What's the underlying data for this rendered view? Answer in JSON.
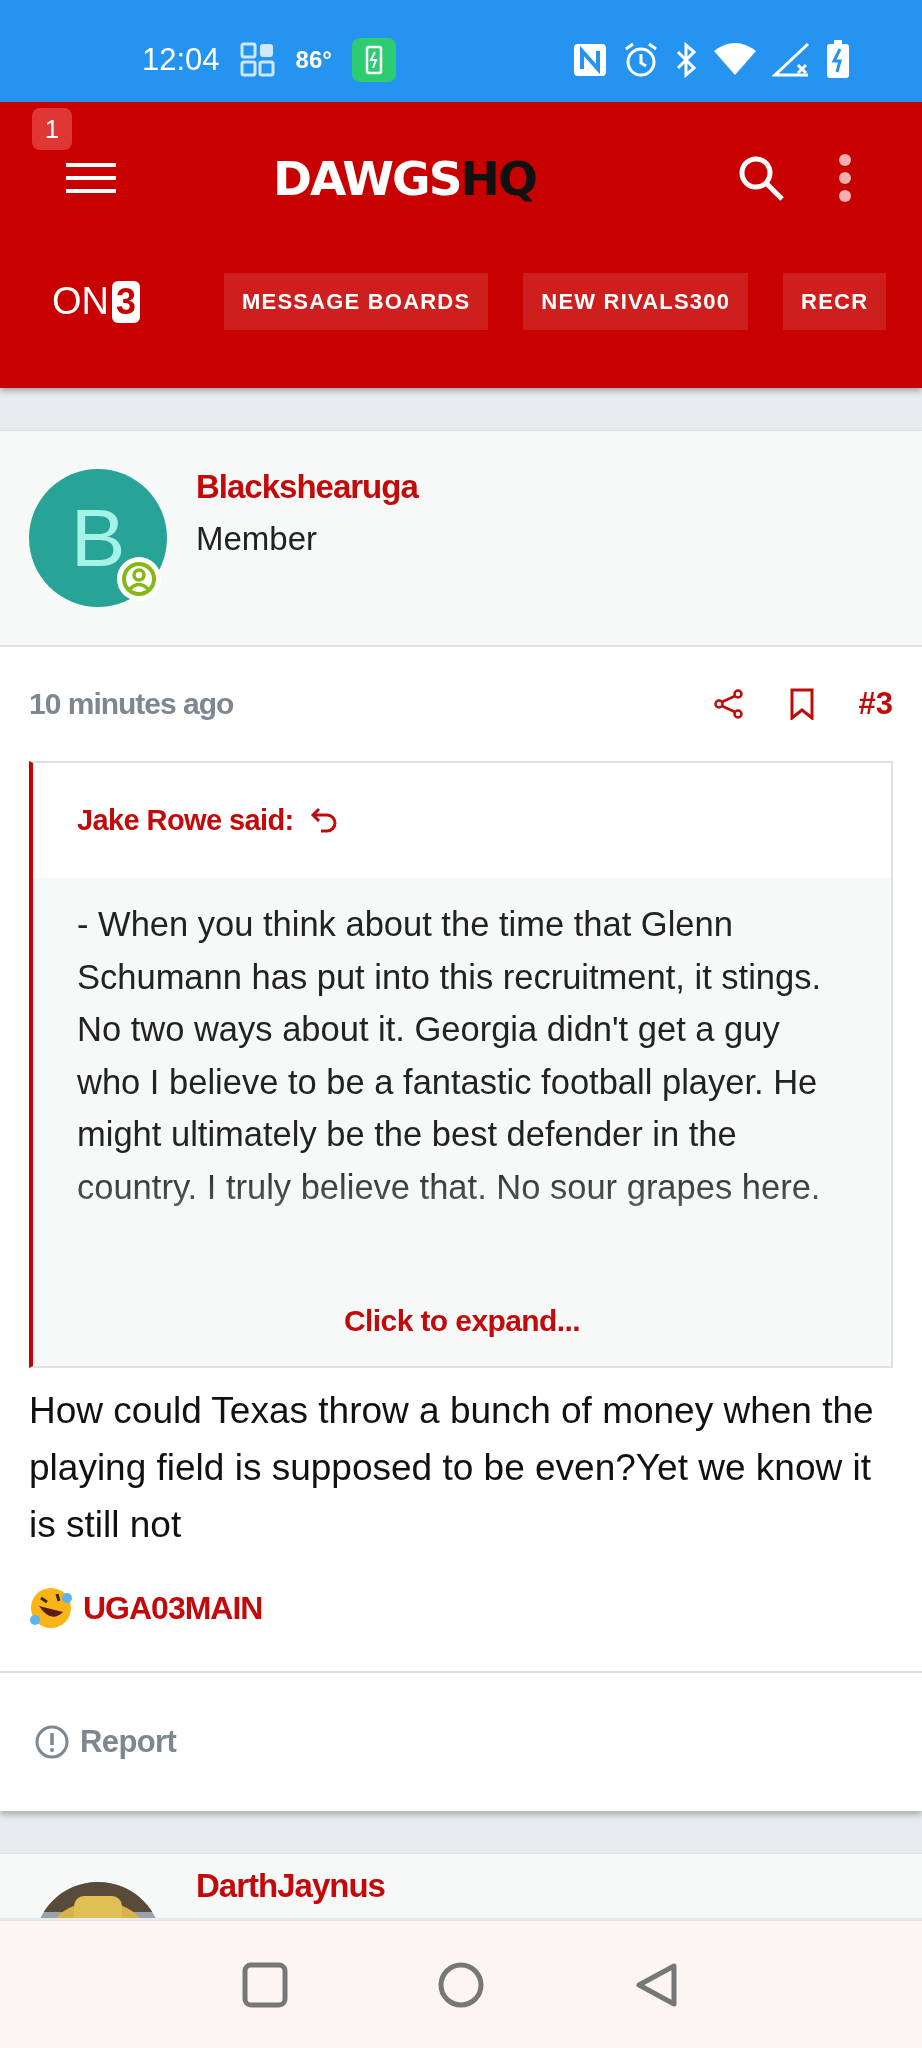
{
  "status_bar": {
    "time": "12:04",
    "temperature": "86°"
  },
  "header": {
    "notification_count": "1",
    "logo": {
      "main": "DAWGS",
      "accent": "HQ"
    },
    "brand": {
      "text": "ON",
      "badge": "3"
    },
    "nav_items": [
      {
        "label": "MESSAGE BOARDS"
      },
      {
        "label": "NEW RIVALS300"
      },
      {
        "label": "RECR"
      }
    ]
  },
  "post": {
    "author": "Blackshearuga",
    "role": "Member",
    "avatar_letter": "B",
    "time": "10 minutes ago",
    "number": "#3",
    "quote": {
      "title": "Jake Rowe said:",
      "text": "- When you think about the time that Glenn Schumann has put into this recruitment, it stings. No two ways about it. Georgia didn't get a guy who I believe to be a fantastic football player. He might ultimately be the best defender in the country. I truly believe that. No sour grapes here.",
      "expand": "Click to expand..."
    },
    "body": "How could Texas throw a bunch of money when the playing field is supposed to be even?Yet we know it is still not",
    "reaction": {
      "user": "UGA03MAIN"
    },
    "report": "Report"
  },
  "next_post": {
    "author": "DarthJaynus"
  }
}
